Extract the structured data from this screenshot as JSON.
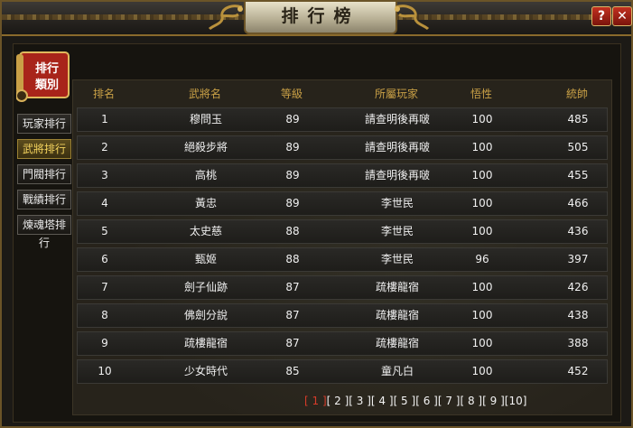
{
  "window": {
    "title": "排行榜",
    "help_label": "?",
    "close_label": "✕"
  },
  "sidebar": {
    "header": [
      "排行",
      "類別"
    ],
    "tabs": [
      {
        "label": "玩家排行",
        "active": false
      },
      {
        "label": "武將排行",
        "active": true
      },
      {
        "label": "門閥排行",
        "active": false
      },
      {
        "label": "戰績排行",
        "active": false
      },
      {
        "label": "煉魂塔排行",
        "active": false
      }
    ]
  },
  "table": {
    "columns": [
      "排名",
      "武將名",
      "等級",
      "所屬玩家",
      "悟性",
      "統帥"
    ],
    "rows": [
      [
        "1",
        "穆問玉",
        "89",
        "請查明後再啵",
        "100",
        "485"
      ],
      [
        "2",
        "絕殺步將",
        "89",
        "請查明後再啵",
        "100",
        "505"
      ],
      [
        "3",
        "高桃",
        "89",
        "請查明後再啵",
        "100",
        "455"
      ],
      [
        "4",
        "黃忠",
        "89",
        "李世民",
        "100",
        "466"
      ],
      [
        "5",
        "太史慈",
        "88",
        "李世民",
        "100",
        "436"
      ],
      [
        "6",
        "甄姬",
        "88",
        "李世民",
        "96",
        "397"
      ],
      [
        "7",
        "劍子仙跡",
        "87",
        "疏樓龍宿",
        "100",
        "426"
      ],
      [
        "8",
        "佛劍分說",
        "87",
        "疏樓龍宿",
        "100",
        "438"
      ],
      [
        "9",
        "疏樓龍宿",
        "87",
        "疏樓龍宿",
        "100",
        "388"
      ],
      [
        "10",
        "少女時代",
        "85",
        "童凡白",
        "100",
        "452"
      ]
    ]
  },
  "pagination": {
    "pages": [
      "[ 1 ]",
      "[ 2 ]",
      "[ 3 ]",
      "[ 4 ]",
      "[ 5 ]",
      "[ 6 ]",
      "[ 7 ]",
      "[ 8 ]",
      "[ 9 ]",
      "[10]"
    ],
    "current_index": 0
  },
  "colors": {
    "accent": "#f4d35e",
    "header": "#c9a046",
    "current_page": "#d63b2a"
  }
}
